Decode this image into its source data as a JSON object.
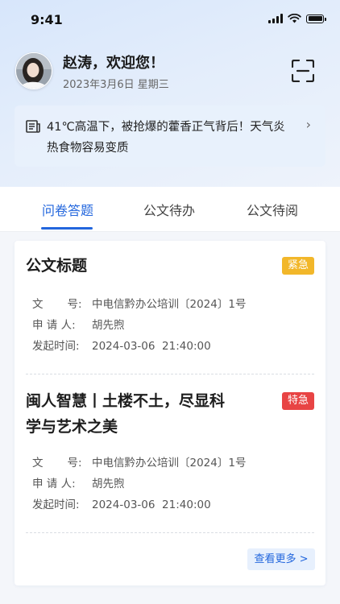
{
  "status_bar": {
    "time": "9:41"
  },
  "header": {
    "greeting": "赵涛，欢迎您！",
    "date": "2023年3月6日   星期三"
  },
  "notice": {
    "text": "41℃高温下，被抢爆的藿香正气背后！天气炎热食物容易变质"
  },
  "tabs": [
    {
      "label": "问卷答题",
      "active": true
    },
    {
      "label": "公文待办",
      "active": false
    },
    {
      "label": "公文待阅",
      "active": false
    }
  ],
  "documents": [
    {
      "title": "公文标题",
      "badge": "紧急",
      "doc_no_label": "文       号:",
      "doc_no": "中电信黔办公培训〔2024〕1号",
      "applicant_label": "申 请 人:",
      "applicant": "胡先煦",
      "time_label": "发起时间:",
      "time": "2024-03-06  21:40:00"
    },
    {
      "title_line1": "闽人智慧丨土楼不土，尽显科",
      "title_line2": "学与艺术之美",
      "badge": "特急",
      "doc_no_label": "文       号:",
      "doc_no": "中电信黔办公培训〔2024〕1号",
      "applicant_label": "申 请 人:",
      "applicant": "胡先煦",
      "time_label": "发起时间:",
      "time": "2024-03-06  21:40:00"
    }
  ],
  "more_button": "查看更多 >",
  "colors": {
    "accent": "#2266dd",
    "urgent": "#f2b72a",
    "special": "#e84444"
  },
  "icons": [
    "signal-icon",
    "wifi-icon",
    "battery-icon",
    "scan-icon",
    "notice-icon",
    "chevron-right-icon"
  ]
}
